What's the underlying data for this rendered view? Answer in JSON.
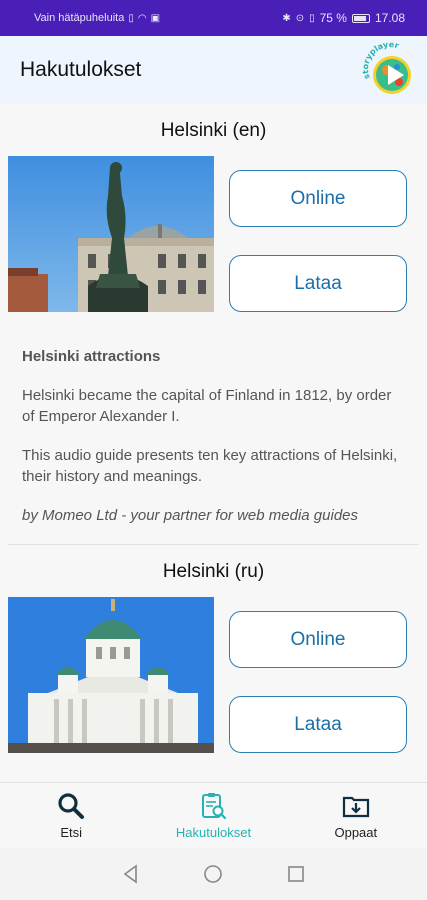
{
  "status_bar": {
    "left_text": "Vain hätäpuheluita",
    "battery_percent": "75 %",
    "battery_level": 0.75,
    "time": "17.08"
  },
  "app_bar": {
    "title": "Hakutulokset",
    "logo_text": "storyplayer"
  },
  "guides": [
    {
      "title": "Helsinki (en)",
      "image": "havis-amanda-statue",
      "online_label": "Online",
      "download_label": "Lataa",
      "desc_title": "Helsinki attractions",
      "paragraphs": [
        "Helsinki became the capital of Finland in 1812, by order of Emperor Alexander I.",
        "This audio guide presents ten key attractions of Helsinki, their history and meanings."
      ],
      "credit": "by Momeo Ltd - your partner for web media guides"
    },
    {
      "title": "Helsinki (ru)",
      "image": "helsinki-cathedral",
      "online_label": "Online",
      "download_label": "Lataa"
    }
  ],
  "bottom_nav": {
    "items": [
      {
        "label": "Etsi",
        "icon": "search-icon",
        "active": false
      },
      {
        "label": "Hakutulokset",
        "icon": "search-results-icon",
        "active": true
      },
      {
        "label": "Oppaat",
        "icon": "download-folder-icon",
        "active": false
      }
    ],
    "active_color": "#27b1b1"
  },
  "colors": {
    "status_bar": "#4a1fb8",
    "app_bar": "#eef5fc",
    "button_border": "#2a7fb0",
    "button_text": "#1a6fa8"
  }
}
